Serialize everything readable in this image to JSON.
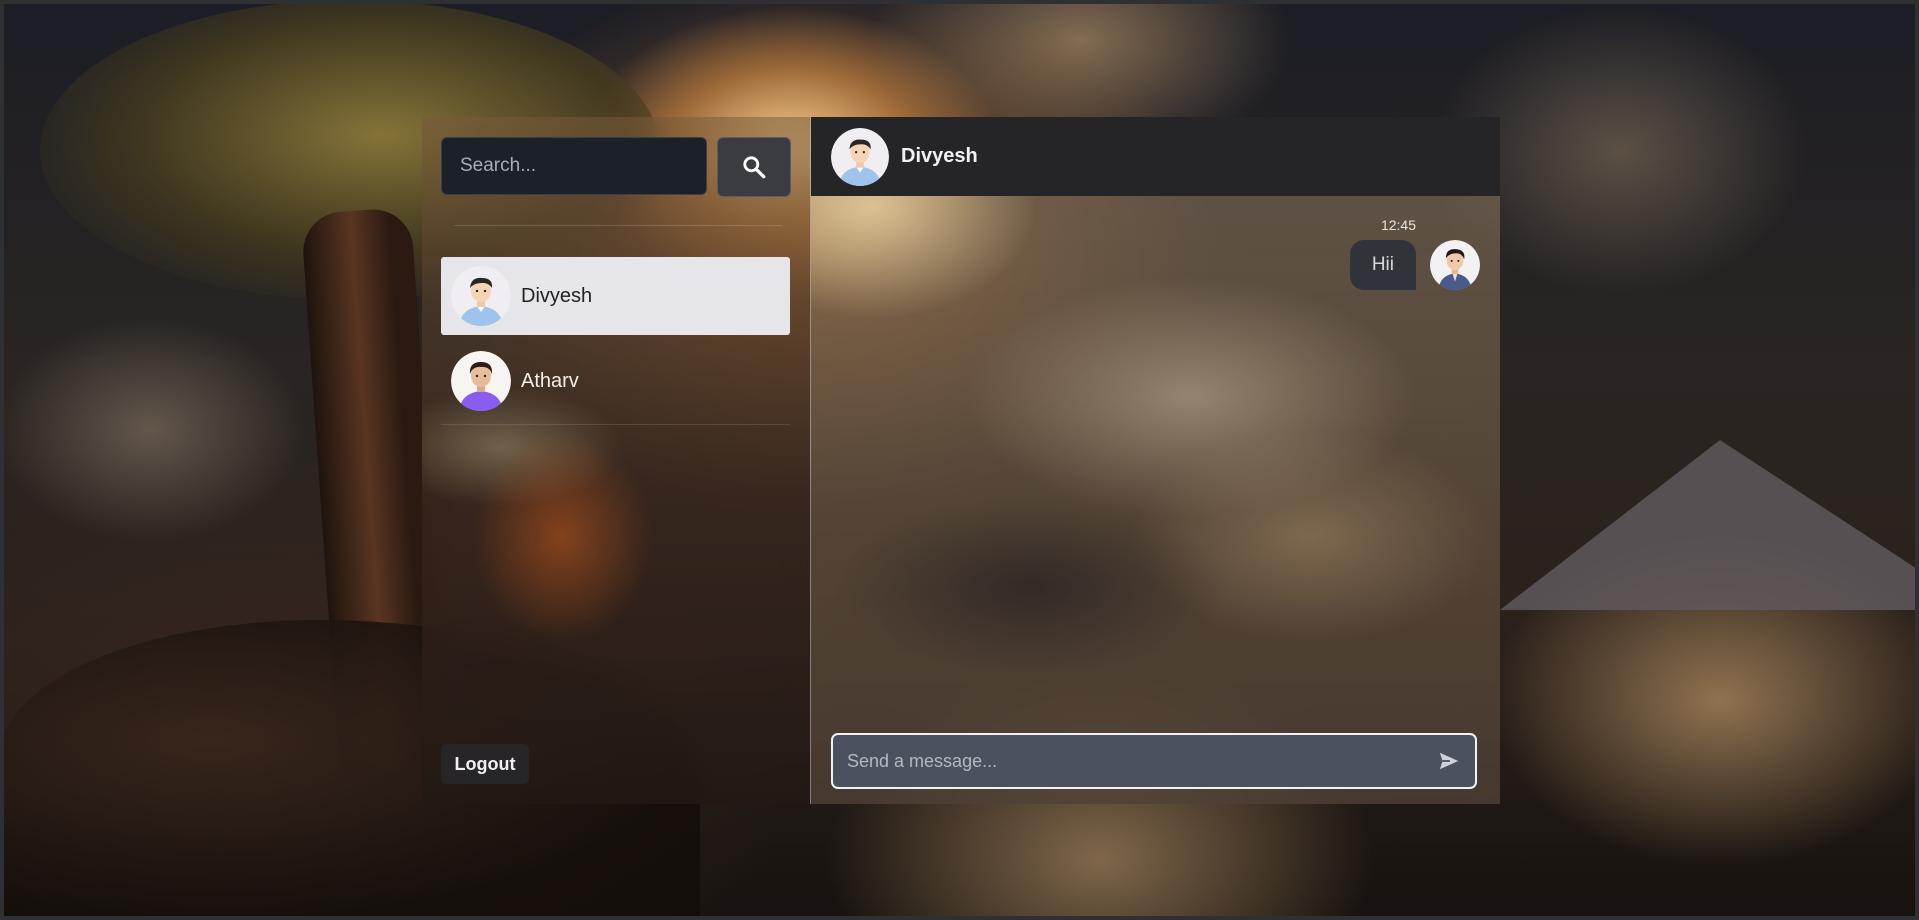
{
  "sidebar": {
    "search": {
      "placeholder": "Search...",
      "button_icon": "search-icon"
    },
    "contacts": [
      {
        "name": "Divyesh",
        "avatar": "man-blue-shirt-avatar",
        "active": true
      },
      {
        "name": "Atharv",
        "avatar": "man-purple-shirt-avatar",
        "active": false
      }
    ],
    "logout_label": "Logout"
  },
  "chat": {
    "header": {
      "name": "Divyesh",
      "avatar": "man-blue-shirt-avatar"
    },
    "messages": [
      {
        "time": "12:45",
        "text": "Hii",
        "sender_avatar": "man-dark-shirt-avatar"
      }
    ],
    "composer": {
      "placeholder": "Send a message...",
      "send_icon": "send-icon"
    }
  },
  "colors": {
    "header_bg": "#252527",
    "active_contact_bg": "#e6e6ea",
    "search_bg": "#1c2129",
    "composer_bg": "#4a5260",
    "bubble_bg": "#2c323a",
    "atharv_shirt": "#8a5cf0",
    "divyesh_shirt": "#9ec3ec"
  }
}
